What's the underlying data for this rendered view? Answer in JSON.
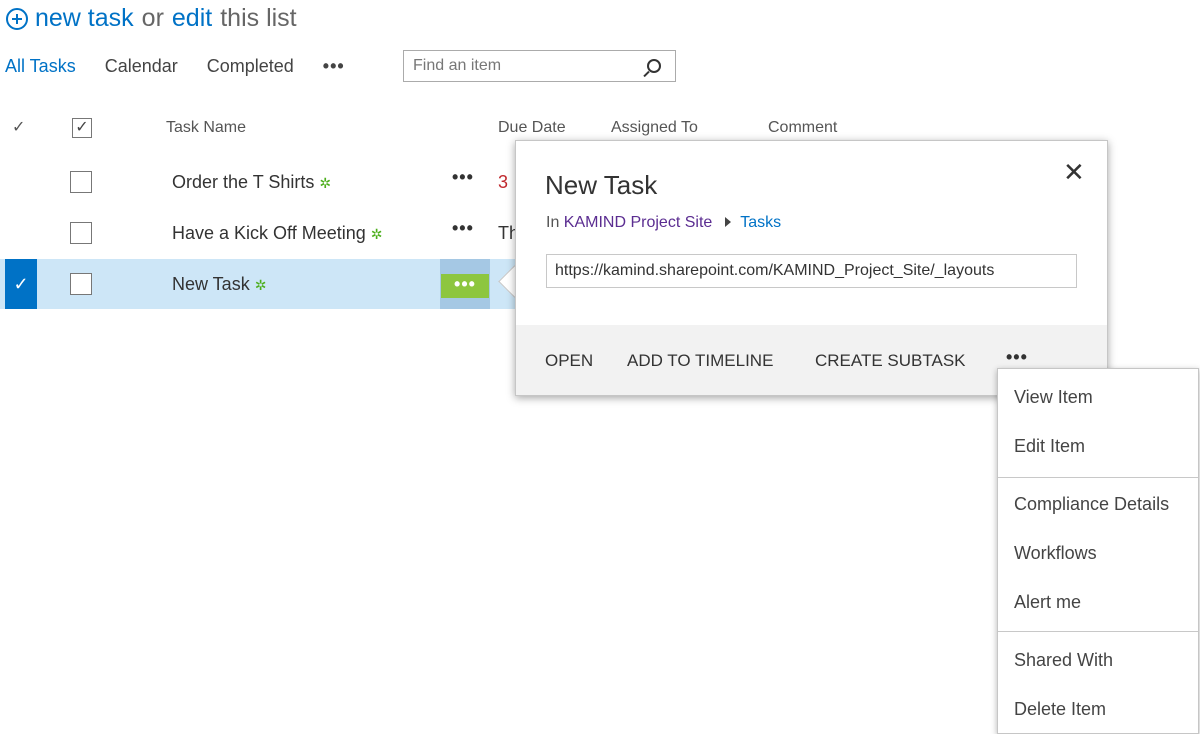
{
  "header": {
    "new_task_label": "new task",
    "or_label": "or",
    "edit_label": "edit",
    "this_list_label": "this list"
  },
  "views": {
    "all_tasks": "All Tasks",
    "calendar": "Calendar",
    "completed": "Completed",
    "more": "•••"
  },
  "search": {
    "placeholder": "Find an item"
  },
  "columns": {
    "check": "✓",
    "task_name": "Task Name",
    "due_date": "Due Date",
    "assigned_to": "Assigned To",
    "comment": "Comment"
  },
  "rows": [
    {
      "title": "Order the T Shirts",
      "dots": "•••",
      "due": "3",
      "due_color": "#c0282d"
    },
    {
      "title": "Have a Kick Off Meeting",
      "dots": "•••",
      "due": "Th",
      "due_color": "#333333"
    },
    {
      "title": "New Task",
      "dots": "•••",
      "selected": true
    }
  ],
  "callout": {
    "title": "New Task",
    "close": "✕",
    "in_label": "In",
    "site": "KAMIND Project Site",
    "list": "Tasks",
    "url": "https://kamind.sharepoint.com/KAMIND_Project_Site/_layouts",
    "open": "OPEN",
    "add_to_timeline": "ADD TO TIMELINE",
    "create_subtask": "CREATE SUBTASK",
    "more": "•••"
  },
  "menu": {
    "items": [
      "View Item",
      "Edit Item",
      "Compliance Details",
      "Workflows",
      "Alert me",
      "Shared With",
      "Delete Item"
    ]
  },
  "colors": {
    "accent": "#0072c6",
    "selected_row": "#cde6f7",
    "new_badge": "#4cae1c",
    "active_dots": "#8dc63f"
  }
}
